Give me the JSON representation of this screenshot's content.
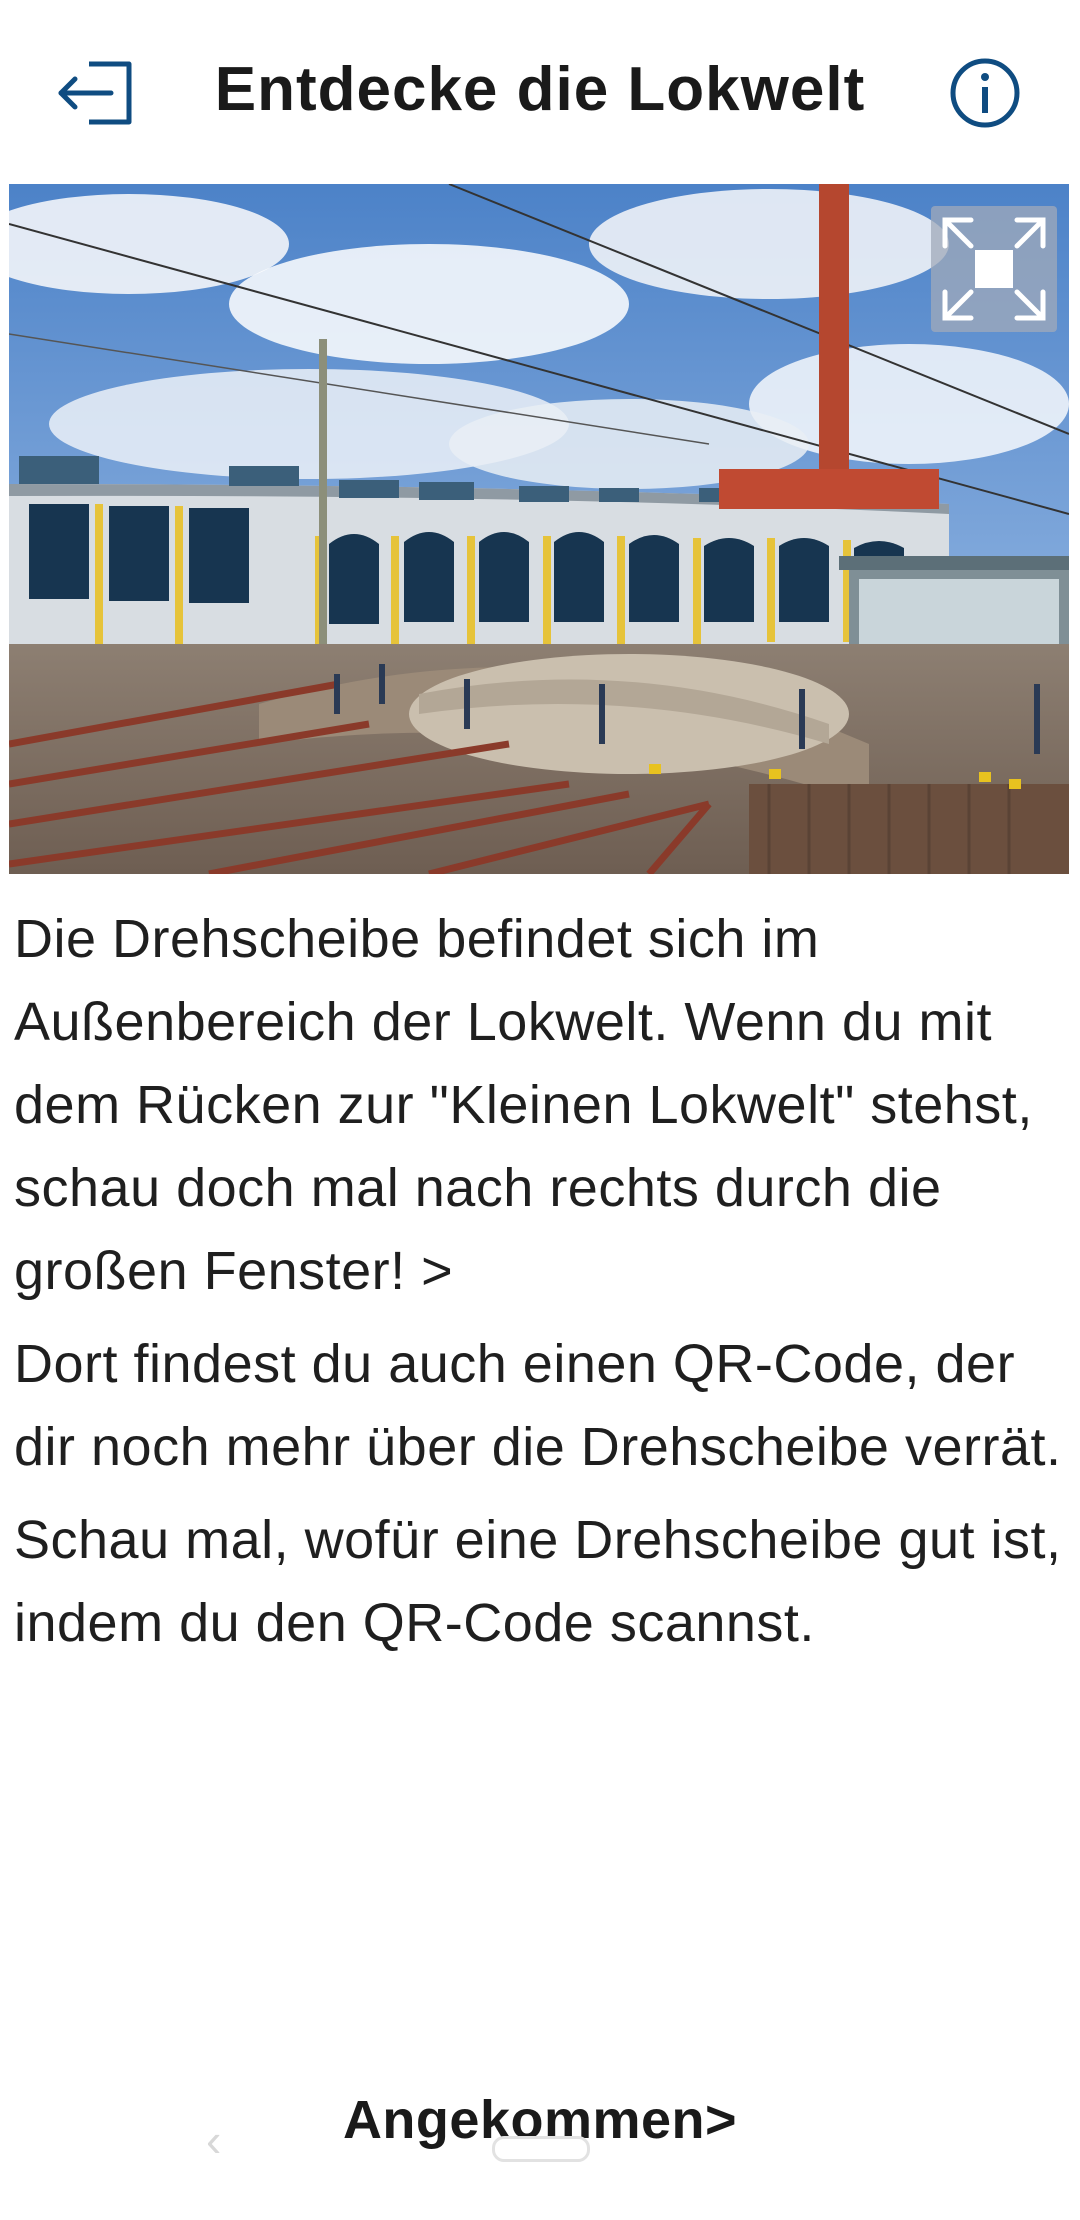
{
  "header": {
    "title": "Entdecke die Lokwelt",
    "exit_icon": "exit-icon",
    "info_icon": "info-icon",
    "accent_color": "#0f4c81"
  },
  "hero": {
    "fullscreen_icon": "fullscreen-icon"
  },
  "content": {
    "paragraphs": [
      "Die Drehscheibe befindet sich im Außenbereich der Lokwelt. Wenn du mit dem Rücken zur \"Kleinen Lokwelt\" stehst, schau doch mal nach rechts durch die großen Fenster! >",
      "Dort findest du auch einen QR-Code, der dir noch mehr über die Drehscheibe verrät.",
      "Schau mal, wofür eine Drehscheibe gut ist, indem du den QR-Code scannst."
    ]
  },
  "footer": {
    "arrived_label": "Angekommen>",
    "back_glyph": "‹"
  }
}
